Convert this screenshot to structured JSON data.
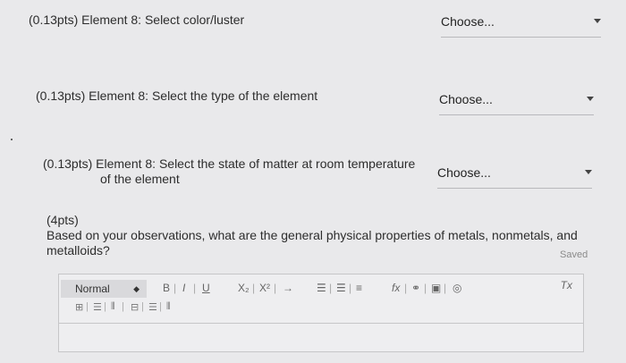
{
  "questions": [
    {
      "label": "(0.13pts)  Element 8: Select color/luster",
      "select": "Choose..."
    },
    {
      "label": "(0.13pts)  Element 8: Select the type of the element",
      "select": "Choose..."
    },
    {
      "label_line1": "(0.13pts)  Element 8: Select the state of matter at room temperature",
      "label_line2": "of the element",
      "select": "Choose..."
    }
  ],
  "essay": {
    "points": "(4pts)",
    "prompt_line1": "Based on your observations, what are the general physical properties of metals, nonmetals, and",
    "prompt_line2": "metalloids?",
    "status": "Saved"
  },
  "editor": {
    "format": "Normal",
    "bold": "B",
    "italic": "I",
    "underline": "U",
    "subscript": "X₂",
    "superscript": "X²",
    "arrow": "→",
    "formula": "fx",
    "clear_format": "Tx"
  }
}
